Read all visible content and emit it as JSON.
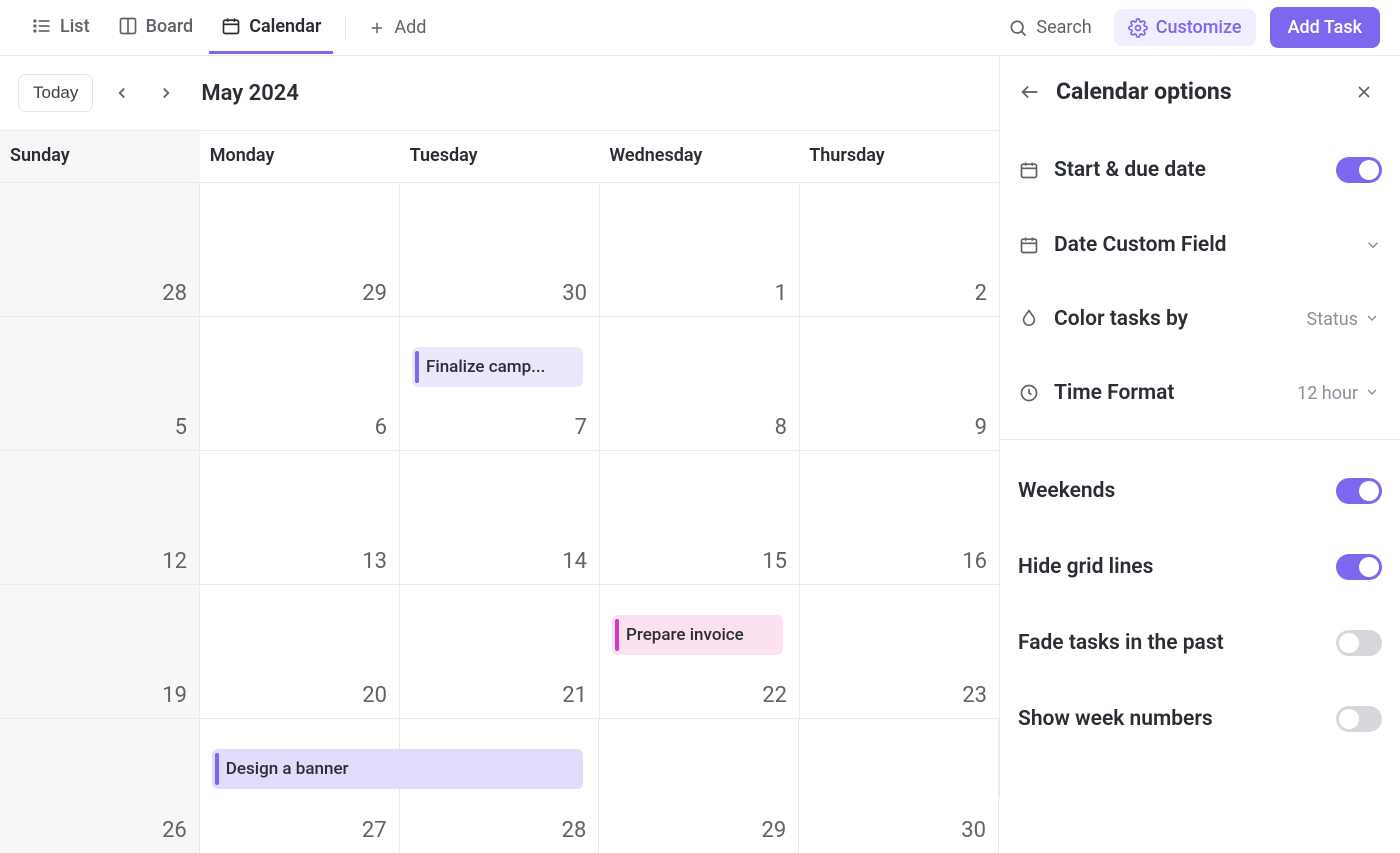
{
  "topbar": {
    "tabs": {
      "list": "List",
      "board": "Board",
      "calendar": "Calendar"
    },
    "add_label": "Add",
    "search_label": "Search",
    "customize_label": "Customize",
    "add_task_label": "Add Task"
  },
  "calendar": {
    "today_label": "Today",
    "month": "May 2024",
    "day_headers": [
      "Sunday",
      "Monday",
      "Tuesday",
      "Wednesday",
      "Thursday"
    ],
    "weeks": [
      [
        "28",
        "29",
        "30",
        "1",
        "2"
      ],
      [
        "5",
        "6",
        "7",
        "8",
        "9"
      ],
      [
        "12",
        "13",
        "14",
        "15",
        "16"
      ],
      [
        "19",
        "20",
        "21",
        "22",
        "23"
      ],
      [
        "26",
        "27",
        "28",
        "29",
        "30"
      ]
    ],
    "tasks": {
      "finalize": "Finalize camp...",
      "prepare_invoice": "Prepare invoice",
      "design_banner": "Design a banner"
    }
  },
  "sidebar": {
    "title": "Calendar options",
    "options": {
      "start_due": {
        "label": "Start & due date",
        "on": true
      },
      "date_cf": {
        "label": "Date Custom Field"
      },
      "color_by": {
        "label": "Color tasks by",
        "value": "Status"
      },
      "time_format": {
        "label": "Time Format",
        "value": "12 hour"
      },
      "weekends": {
        "label": "Weekends",
        "on": true
      },
      "hide_grid": {
        "label": "Hide grid lines",
        "on": true
      },
      "fade_past": {
        "label": "Fade tasks in the past",
        "on": false
      },
      "week_numbers": {
        "label": "Show week numbers",
        "on": false
      }
    }
  }
}
